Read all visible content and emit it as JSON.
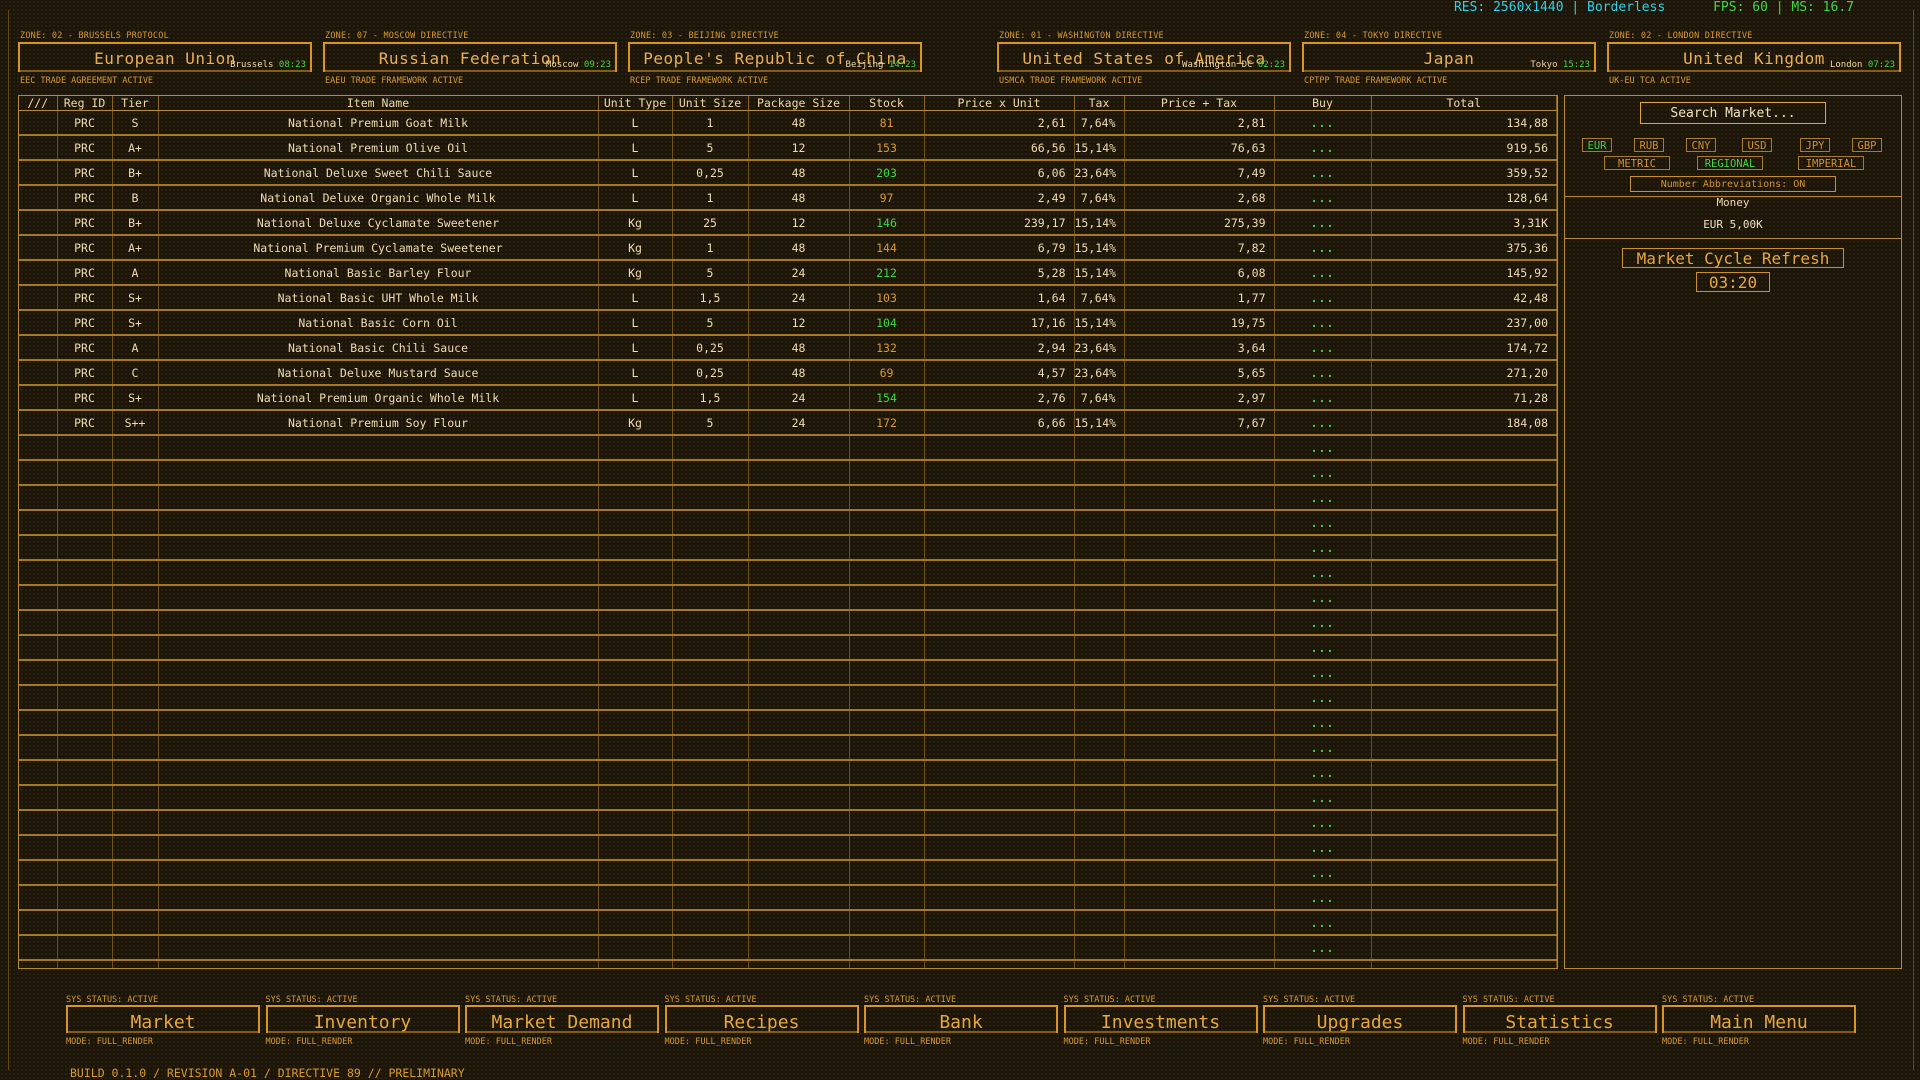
{
  "system": {
    "resolution": "RES: 2560x1440 | Borderless",
    "performance": "FPS: 60 | MS: 16.7"
  },
  "regions": [
    {
      "zone": "ZONE: 02 - BRUSSELS PROTOCOL",
      "name": "European Union",
      "city": "Brussels",
      "time": "08:23",
      "agreement": "EEC TRADE AGREEMENT ACTIVE"
    },
    {
      "zone": "ZONE: 07 - MOSCOW DIRECTIVE",
      "name": "Russian Federation",
      "city": "Moscow",
      "time": "09:23",
      "agreement": "EAEU TRADE FRAMEWORK ACTIVE"
    },
    {
      "zone": "ZONE: 03 - BEIJING DIRECTIVE",
      "name": "People's Republic of China",
      "city": "Beijing",
      "time": "14:23",
      "agreement": "RCEP TRADE FRAMEWORK ACTIVE"
    },
    {
      "zone": "ZONE: 01 - WASHINGTON DIRECTIVE",
      "name": "United States of America",
      "city": "Washington DC",
      "time": "02:23",
      "agreement": "USMCA TRADE FRAMEWORK ACTIVE"
    },
    {
      "zone": "ZONE: 04 - TOKYO DIRECTIVE",
      "name": "Japan",
      "city": "Tokyo",
      "time": "15:23",
      "agreement": "CPTPP TRADE FRAMEWORK ACTIVE"
    },
    {
      "zone": "ZONE: 02 - LONDON DIRECTIVE",
      "name": "United Kingdom",
      "city": "London",
      "time": "07:23",
      "agreement": "UK-EU TCA ACTIVE"
    }
  ],
  "table": {
    "headers": [
      "///",
      "Reg ID",
      "Tier",
      "Item Name",
      "Unit Type",
      "Unit Size",
      "Package Size",
      "Stock",
      "Price x Unit",
      "Tax",
      "Price + Tax",
      "Buy",
      "Total"
    ],
    "buy_label": "...",
    "empty_rows": 23,
    "rows": [
      {
        "reg": "PRC",
        "tier": "S",
        "name": "National Premium Goat Milk",
        "unit_type": "L",
        "unit_size": "1",
        "package": "48",
        "stock": "81",
        "stock_color": "orange",
        "price": "2,61",
        "tax": "7,64%",
        "price_tax": "2,81",
        "total": "134,88"
      },
      {
        "reg": "PRC",
        "tier": "A+",
        "name": "National Premium Olive Oil",
        "unit_type": "L",
        "unit_size": "5",
        "package": "12",
        "stock": "153",
        "stock_color": "orange",
        "price": "66,56",
        "tax": "15,14%",
        "price_tax": "76,63",
        "total": "919,56"
      },
      {
        "reg": "PRC",
        "tier": "B+",
        "name": "National Deluxe Sweet Chili Sauce",
        "unit_type": "L",
        "unit_size": "0,25",
        "package": "48",
        "stock": "203",
        "stock_color": "green",
        "price": "6,06",
        "tax": "23,64%",
        "price_tax": "7,49",
        "total": "359,52"
      },
      {
        "reg": "PRC",
        "tier": "B",
        "name": "National Deluxe Organic Whole Milk",
        "unit_type": "L",
        "unit_size": "1",
        "package": "48",
        "stock": "97",
        "stock_color": "orange",
        "price": "2,49",
        "tax": "7,64%",
        "price_tax": "2,68",
        "total": "128,64"
      },
      {
        "reg": "PRC",
        "tier": "B+",
        "name": "National Deluxe Cyclamate Sweetener",
        "unit_type": "Kg",
        "unit_size": "25",
        "package": "12",
        "stock": "146",
        "stock_color": "green",
        "price": "239,17",
        "tax": "15,14%",
        "price_tax": "275,39",
        "total": "3,31K"
      },
      {
        "reg": "PRC",
        "tier": "A+",
        "name": "National Premium Cyclamate Sweetener",
        "unit_type": "Kg",
        "unit_size": "1",
        "package": "48",
        "stock": "144",
        "stock_color": "orange",
        "price": "6,79",
        "tax": "15,14%",
        "price_tax": "7,82",
        "total": "375,36"
      },
      {
        "reg": "PRC",
        "tier": "A",
        "name": "National Basic Barley Flour",
        "unit_type": "Kg",
        "unit_size": "5",
        "package": "24",
        "stock": "212",
        "stock_color": "green",
        "price": "5,28",
        "tax": "15,14%",
        "price_tax": "6,08",
        "total": "145,92"
      },
      {
        "reg": "PRC",
        "tier": "S+",
        "name": "National Basic UHT Whole Milk",
        "unit_type": "L",
        "unit_size": "1,5",
        "package": "24",
        "stock": "103",
        "stock_color": "orange",
        "price": "1,64",
        "tax": "7,64%",
        "price_tax": "1,77",
        "total": "42,48"
      },
      {
        "reg": "PRC",
        "tier": "S+",
        "name": "National Basic Corn Oil",
        "unit_type": "L",
        "unit_size": "5",
        "package": "12",
        "stock": "104",
        "stock_color": "green",
        "price": "17,16",
        "tax": "15,14%",
        "price_tax": "19,75",
        "total": "237,00"
      },
      {
        "reg": "PRC",
        "tier": "A",
        "name": "National Basic Chili Sauce",
        "unit_type": "L",
        "unit_size": "0,25",
        "package": "48",
        "stock": "132",
        "stock_color": "orange",
        "price": "2,94",
        "tax": "23,64%",
        "price_tax": "3,64",
        "total": "174,72"
      },
      {
        "reg": "PRC",
        "tier": "C",
        "name": "National Deluxe Mustard Sauce",
        "unit_type": "L",
        "unit_size": "0,25",
        "package": "48",
        "stock": "69",
        "stock_color": "orange",
        "price": "4,57",
        "tax": "23,64%",
        "price_tax": "5,65",
        "total": "271,20"
      },
      {
        "reg": "PRC",
        "tier": "S+",
        "name": "National Premium Organic Whole Milk",
        "unit_type": "L",
        "unit_size": "1,5",
        "package": "24",
        "stock": "154",
        "stock_color": "green",
        "price": "2,76",
        "tax": "7,64%",
        "price_tax": "2,97",
        "total": "71,28"
      },
      {
        "reg": "PRC",
        "tier": "S++",
        "name": "National Premium Soy Flour",
        "unit_type": "Kg",
        "unit_size": "5",
        "package": "24",
        "stock": "172",
        "stock_color": "orange",
        "price": "6,66",
        "tax": "15,14%",
        "price_tax": "7,67",
        "total": "184,08"
      }
    ]
  },
  "panel": {
    "search_placeholder": "Search Market...",
    "currencies": [
      "EUR",
      "RUB",
      "CNY",
      "USD",
      "JPY",
      "GBP"
    ],
    "active_currency": "EUR",
    "units": [
      "METRIC",
      "REGIONAL",
      "IMPERIAL"
    ],
    "active_unit": "REGIONAL",
    "abbreviations": "Number Abbreviations: ON",
    "money_label": "Money",
    "money_value": "EUR 5,00K",
    "refresh_label": "Market Cycle Refresh",
    "refresh_timer": "03:20"
  },
  "nav": {
    "status": "SYS STATUS: ACTIVE",
    "mode": "MODE: FULL_RENDER",
    "items": [
      "Market",
      "Inventory",
      "Market Demand",
      "Recipes",
      "Bank",
      "Investments",
      "Upgrades",
      "Statistics",
      "Main Menu"
    ]
  },
  "footer": {
    "build": "BUILD 0.1.0 / REVISION A-01 / DIRECTIVE 89 // PRELIMINARY"
  },
  "colors": {
    "accent": "#d8961e",
    "text": "#e6bd7a",
    "positive": "#3fd73f",
    "info": "#22c7d6",
    "background": "#1c150a"
  }
}
